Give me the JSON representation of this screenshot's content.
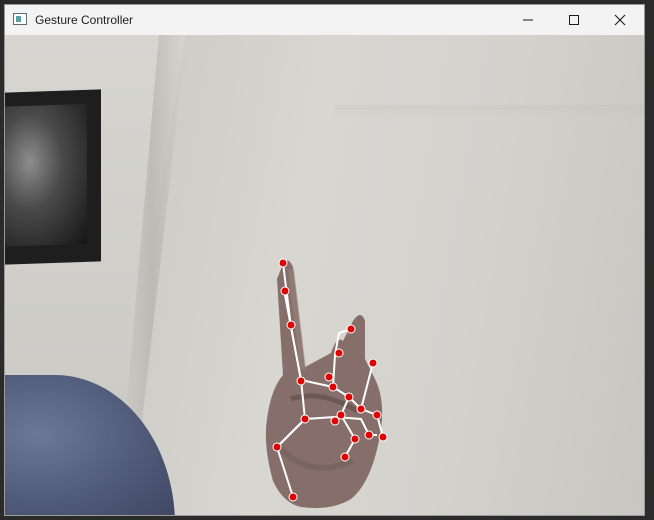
{
  "window": {
    "title": "Gesture Controller",
    "icons": {
      "app": "app-window-icon",
      "minimize": "minimize-icon",
      "maximize": "maximize-icon",
      "close": "close-icon"
    }
  },
  "feed": {
    "landmark_color": "#e00000",
    "connection_color": "#ffffff",
    "landmark_count": 21
  }
}
